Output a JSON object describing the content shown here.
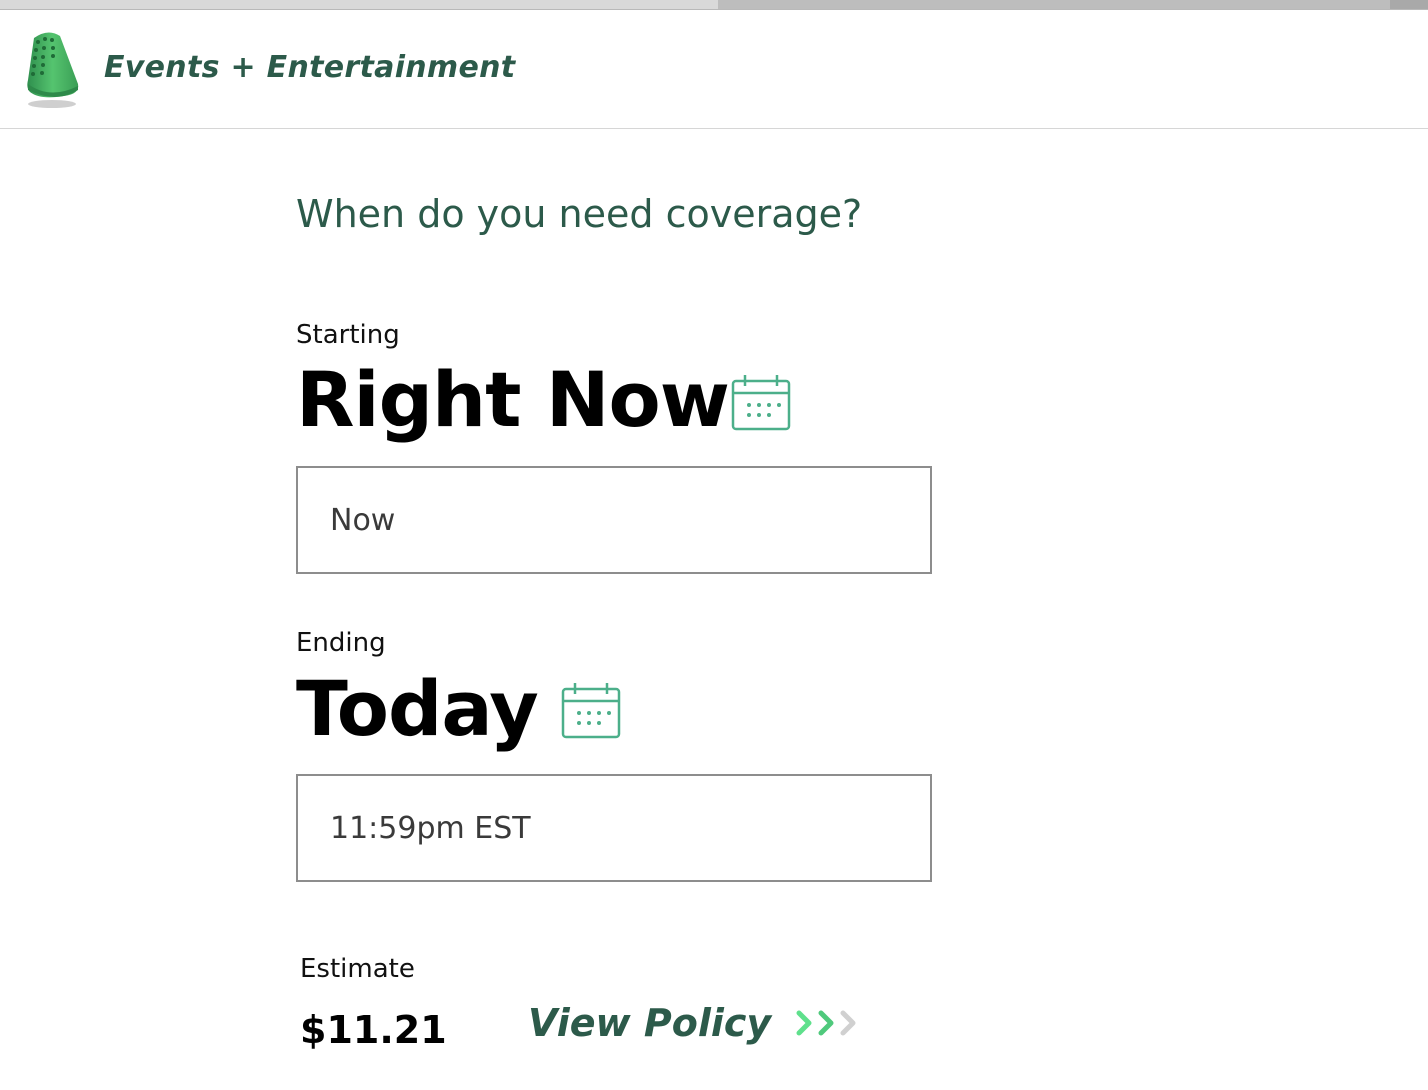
{
  "header": {
    "brand": "Events + Entertainment",
    "logo_icon": "thimble-icon"
  },
  "main": {
    "question": "When do you need coverage?",
    "start": {
      "label": "Starting",
      "title": "Right Now",
      "calendar_icon": "calendar-icon",
      "value": "Now"
    },
    "end": {
      "label": "Ending",
      "title": "Today",
      "calendar_icon": "calendar-icon",
      "value": "11:59pm EST"
    },
    "estimate": {
      "label": "Estimate",
      "value": "$11.21"
    },
    "view_policy": {
      "label": "View Policy",
      "icon": "chevrons-right-icon"
    }
  },
  "colors": {
    "brand_green": "#2c5a4a",
    "accent_green": "#4caf8a",
    "chevron_bright": "#5fe08c",
    "chevron_faded": "#d0d0d0"
  }
}
